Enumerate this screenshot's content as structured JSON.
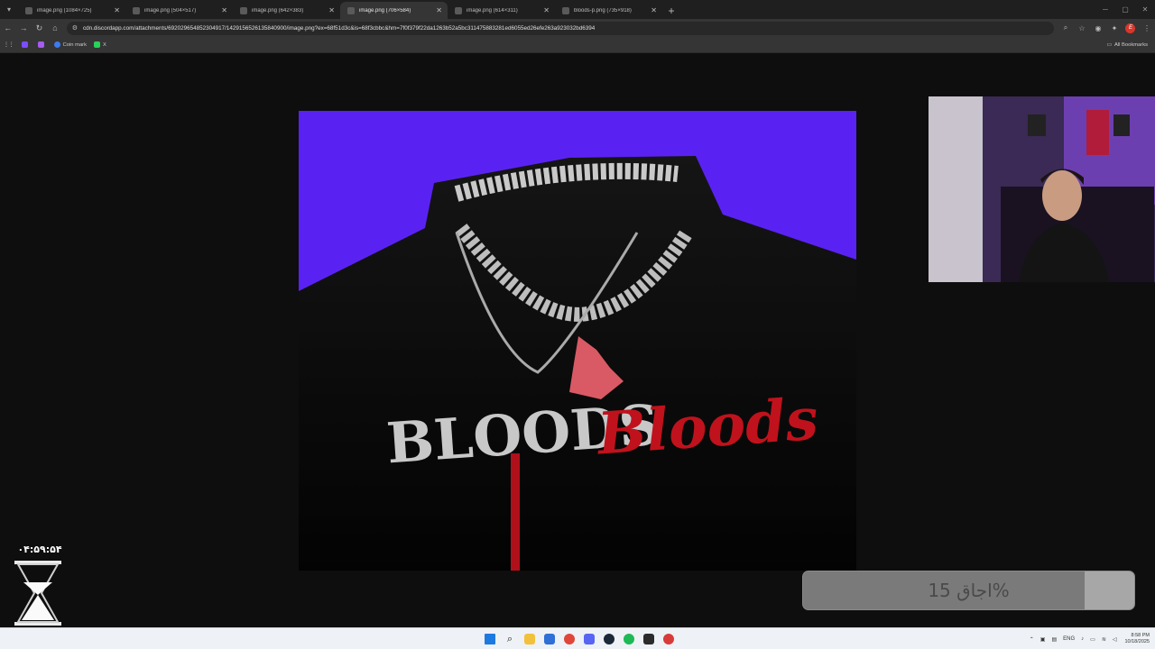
{
  "browser": {
    "tabs": [
      {
        "title": "image.png (1084×725)",
        "active": false
      },
      {
        "title": "image.png (504×517)",
        "active": false
      },
      {
        "title": "image.png (642×383)",
        "active": false
      },
      {
        "title": "image.png (706×584)",
        "active": true
      },
      {
        "title": "image.png (614×311)",
        "active": false
      },
      {
        "title": "bloods-p.png (735×918)",
        "active": false
      }
    ],
    "new_tab_label": "+",
    "url": "cdn.discordapp.com/attachments/692029654852304917/1429156526135840900/image.png?ex=68f51d3c&is=68f3cbbc&hm=7f0f379f22da1263b52a5bc311475883281ed6055ed26efe263a923032bd6394",
    "bookmarks": [
      {
        "label": "",
        "icon": "discord-purple-icon"
      },
      {
        "label": "",
        "icon": "vpn-icon"
      },
      {
        "label": "Coin mark",
        "icon": "coin-icon"
      },
      {
        "label": "X",
        "icon": "kick-icon"
      }
    ],
    "all_bookmarks_label": "All Bookmarks"
  },
  "image": {
    "logo_text_white": "BLOODS",
    "logo_text_red": "Bloods",
    "background_color": "#5a22f2"
  },
  "overlay": {
    "timer": "۰۴:۵۹:۵۴",
    "loading_text": "اجاق 15%",
    "loading_progress": 0.15
  },
  "taskbar": {
    "language": "ENG",
    "time": "8:58 PM",
    "date": "10/18/2025"
  }
}
